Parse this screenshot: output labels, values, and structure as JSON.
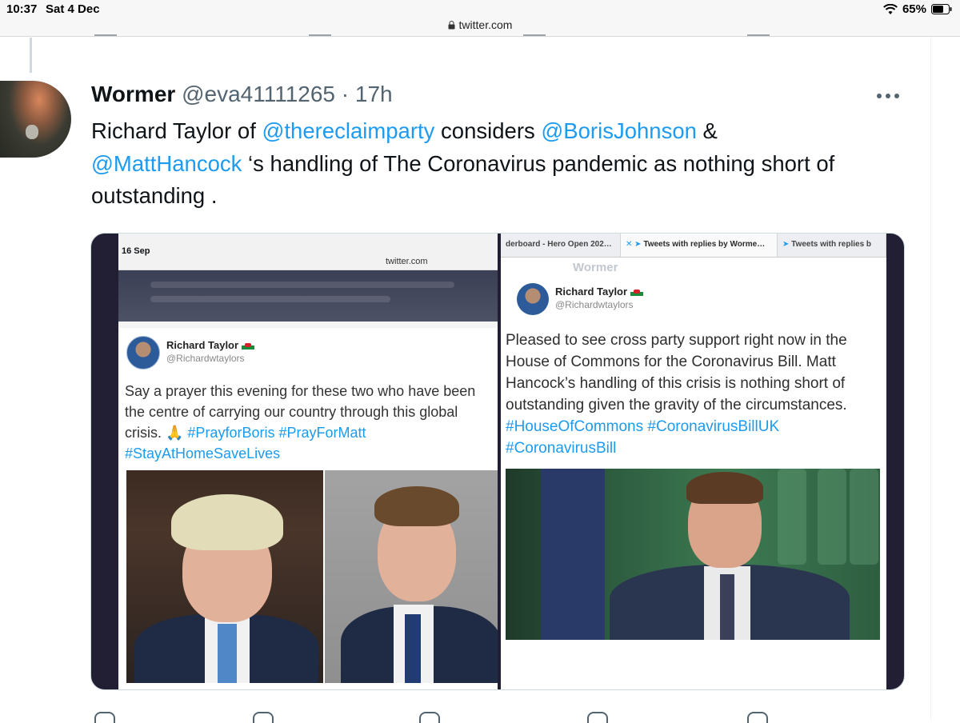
{
  "status_bar": {
    "time": "10:37",
    "date": "Sat 4 Dec",
    "battery": "65%",
    "url": "twitter.com"
  },
  "tweet": {
    "display_name": "Wormer",
    "handle": "@eva41111265",
    "separator": "·",
    "time": "17h",
    "text_parts": {
      "p1": "Richard Taylor of ",
      "m1": "@thereclaimparty",
      "p2": " considers ",
      "m2": "@BorisJohnson",
      "p3": " & ",
      "m3": "@MattHancock",
      "p4": " ‘s handling of The Coronavirus pandemic as nothing short of outstanding ."
    }
  },
  "media_left": {
    "date": "16 Sep",
    "url": "twitter.com",
    "name": "Richard Taylor",
    "handle": "@Richardwtaylors",
    "text": "Say a prayer this evening for these two who have been the centre of carrying our country through this global crisis. 🙏 ",
    "hashtags": "#PrayforBoris #PrayForMatt #StayAtHomeSaveLives"
  },
  "media_right": {
    "tabs": [
      "derboard - Hero Open 202…",
      "Tweets with replies by Worme…",
      "Tweets with replies b"
    ],
    "shadow_title": "Wormer",
    "name": "Richard Taylor",
    "handle": "@Richardwtaylors",
    "text": "Pleased to see cross party support right now in the House of Commons for the Coronavirus Bill.  Matt Hancock’s handling of this crisis is nothing short of outstanding given the gravity of the circumstances. ",
    "hashtags": "#HouseOfCommons #CoronavirusBillUK #CoronavirusBill"
  },
  "colors": {
    "link": "#1d9bf0",
    "text": "#0f1419",
    "muted": "#536471"
  }
}
